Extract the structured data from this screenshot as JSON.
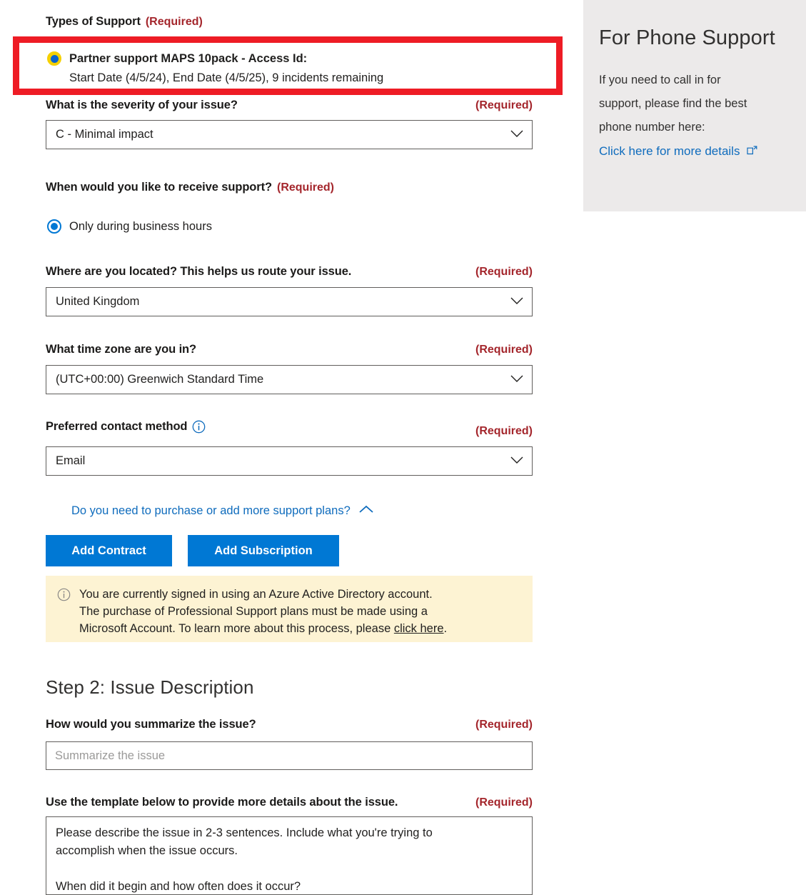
{
  "colors": {
    "accent": "#0078d4",
    "required": "#a4262c",
    "link": "#0f6cbd",
    "annotation": "#ee1c25",
    "banner_bg": "#fdf3d3",
    "panel_bg": "#eceaea",
    "highlight_ring": "#f5d000"
  },
  "form": {
    "types_of_support": {
      "label": "Types of Support",
      "required": "(Required)",
      "option": {
        "title": "Partner support MAPS 10pack - Access Id:",
        "detail": "Start Date (4/5/24), End Date (4/5/25), 9 incidents remaining",
        "selected": true
      }
    },
    "severity": {
      "label": "What is the severity of your issue?",
      "required": "(Required)",
      "value": "C - Minimal impact"
    },
    "support_time": {
      "label": "When would you like to receive support?",
      "required": "(Required)",
      "option": "Only during business hours"
    },
    "location": {
      "label": "Where are you located? This helps us route your issue.",
      "required": "(Required)",
      "value": "United Kingdom"
    },
    "timezone": {
      "label": "What time zone are you in?",
      "required": "(Required)",
      "value": "(UTC+00:00) Greenwich Standard Time"
    },
    "contact_method": {
      "label": "Preferred contact method",
      "required": "(Required)",
      "value": "Email"
    },
    "expander": {
      "text": "Do you need to purchase or add more support plans?"
    },
    "buttons": {
      "add_contract": "Add Contract",
      "add_subscription": "Add Subscription"
    },
    "banner": {
      "line1": "You are currently signed in using an Azure Active Directory account.",
      "line2": "The purchase of Professional Support plans must be made using a",
      "line3_pre": "Microsoft Account. To learn more about this process, please ",
      "link": "click here",
      "line3_post": "."
    }
  },
  "step2": {
    "title": "Step 2: Issue Description",
    "summary": {
      "label": "How would you summarize the issue?",
      "required": "(Required)",
      "placeholder": "Summarize the issue"
    },
    "details": {
      "label": "Use the template below to provide more details about the issue.",
      "required": "(Required)",
      "value": "Please describe the issue in 2-3 sentences. Include what you're trying to\naccomplish when the issue occurs.\n\nWhen did it begin and how often does it occur?"
    }
  },
  "phone_panel": {
    "title": "For Phone Support",
    "body_line1": "If you need to call in for",
    "body_line2": "support, please find the best",
    "body_line3": "phone number here:",
    "link": "Click here for more details"
  }
}
